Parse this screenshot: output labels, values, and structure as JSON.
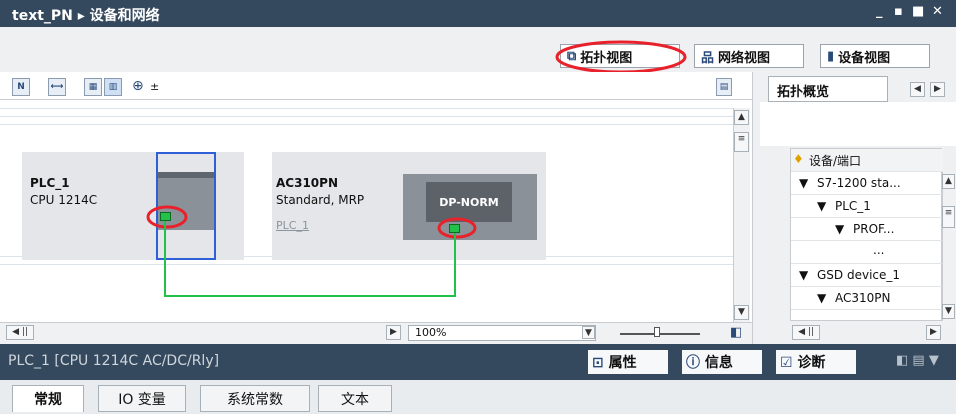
{
  "window": {
    "title": "text_PN ▸ 设备和网络",
    "min": "_",
    "restore": "▪",
    "max": "■",
    "close": "✕"
  },
  "view_tabs": {
    "topology": "拓扑视图",
    "network": "网络视图",
    "device": "设备视图"
  },
  "canvas": {
    "plc": {
      "name": "PLC_1",
      "cpu": "CPU 1214C"
    },
    "ac": {
      "name": "AC310PN",
      "type": "Standard, MRP",
      "link": "PLC_1",
      "module_label": "DP-NORM"
    }
  },
  "zoom": {
    "value": "100%"
  },
  "overview": {
    "tab": "拓扑概览",
    "header": "设备/端口",
    "rows": [
      {
        "label": "S7-1200 sta...",
        "arrow": "▼"
      },
      {
        "label": "PLC_1",
        "arrow": "▼"
      },
      {
        "label": "PROF...",
        "arrow": "▼"
      },
      {
        "label": "...",
        "arrow": ""
      },
      {
        "label": "GSD device_1",
        "arrow": "▼"
      },
      {
        "label": "AC310PN",
        "arrow": "▼"
      }
    ]
  },
  "status": {
    "selected": "PLC_1 [CPU 1214C AC/DC/Rly]",
    "properties": "属性",
    "info": "信息",
    "diagnostics": "诊断"
  },
  "property_tabs": {
    "general": "常规",
    "io_vars": "IO 变量",
    "sys_consts": "系统常数",
    "text": "文本"
  },
  "colors": {
    "titlebar": "#35495e",
    "port": "#22c24a",
    "annotation": "#e8212b",
    "selection": "#2f5fd6"
  }
}
